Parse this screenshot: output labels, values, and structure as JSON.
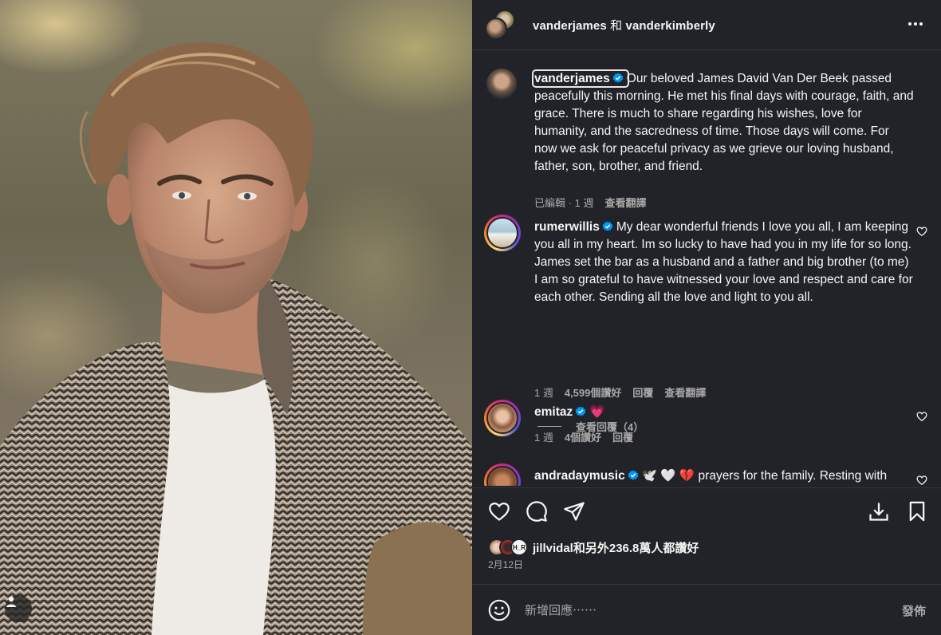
{
  "header": {
    "author1": "vanderjames",
    "conjunction": "和",
    "author2": "vanderkimberly"
  },
  "caption": {
    "username": "vanderjames",
    "text": "Our beloved James David Van Der Beek passed peacefully this morning. He met his final days with courage, faith, and grace. There is much to share regarding his wishes, love for humanity, and the sacredness of time. Those days will come. For now we ask for peaceful privacy as we grieve our loving husband, father, son, brother, and friend.",
    "edited": "已編輯",
    "dot": "·",
    "age": "1 週",
    "translate": "查看翻譯"
  },
  "comments": [
    {
      "username": "rumerwillis",
      "text": "My dear wonderful friends I love you all, I am keeping you all in my heart. Im so lucky to have had you in my life for so long. James set the bar as a husband and a father and big brother (to me) I am so grateful to have witnessed your love and respect and care for each other. Sending all the love and light to you all.",
      "age": "1 週",
      "likes": "4,599個讚好",
      "reply": "回覆",
      "translate": "查看翻譯",
      "view_replies": "查看回覆（4）"
    },
    {
      "username": "emitaz",
      "text": "💗",
      "age": "1 週",
      "likes": "4個讚好",
      "reply": "回覆"
    },
    {
      "username": "andradaymusic",
      "text": "🕊️ 🤍 💔 prayers for the family. Resting with"
    }
  ],
  "likes_summary": {
    "text": "jillvidal和另外236.8萬人都讚好",
    "badge": "H_R"
  },
  "post_date": "2月12日",
  "composer": {
    "placeholder": "新增回應⋯⋯",
    "post_label": "發佈"
  },
  "colors": {
    "panel_bg": "#212328",
    "verified": "#0095f6",
    "muted": "#a8a8a8"
  },
  "icons": [
    "more-icon",
    "verified-icon",
    "heart-icon",
    "comment-icon",
    "share-icon",
    "save-icon",
    "bookmark-icon",
    "emoji-icon",
    "user-tag-icon"
  ]
}
